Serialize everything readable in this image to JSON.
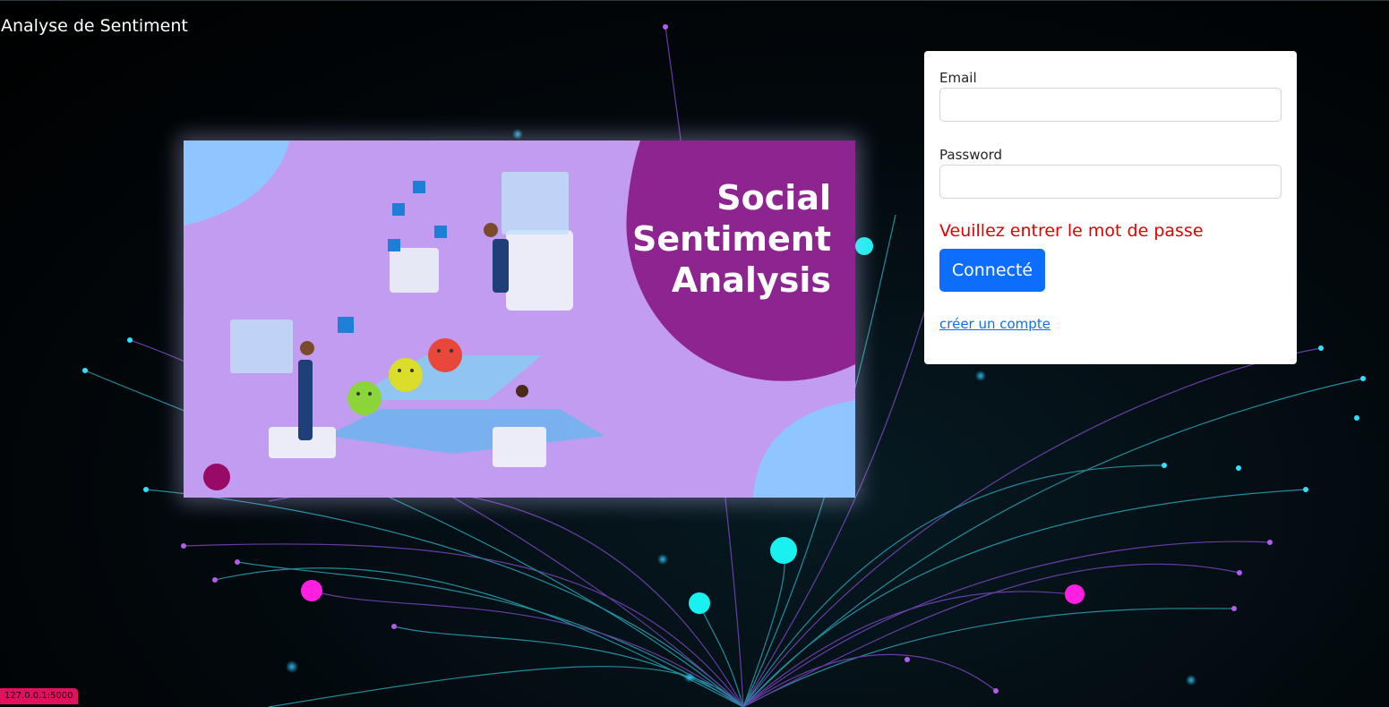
{
  "app": {
    "title": "Analyse de Sentiment"
  },
  "hero": {
    "title_line1": "Social",
    "title_line2": "Sentiment",
    "title_line3": "Analysis",
    "colors": {
      "background": "#c29cf0",
      "blob": "#8d2490",
      "accent_blue": "#8fc6ff"
    }
  },
  "login": {
    "email_label": "Email",
    "email_value": "",
    "password_label": "Password",
    "password_value": "",
    "error_message": "Veuillez entrer le mot de passe",
    "submit_label": "Connecté",
    "register_link": "créer un compte",
    "colors": {
      "primary": "#0d6efd",
      "error": "#e60000"
    }
  },
  "status": {
    "host": "127.0.0.1:5000"
  }
}
